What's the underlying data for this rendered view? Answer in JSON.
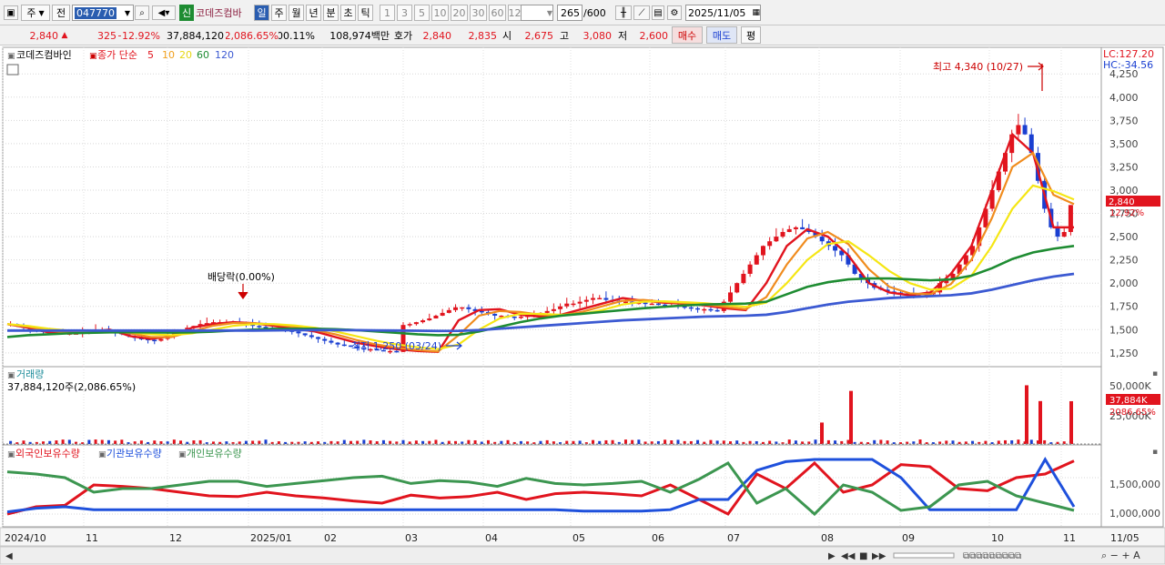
{
  "toolbar": {
    "type_combo": "주",
    "prev_label": "전",
    "stock_code": "047770",
    "new_badge": "신",
    "stock_name": "코데즈컴바",
    "periods": [
      "일",
      "주",
      "월",
      "년",
      "분",
      "초",
      "틱"
    ],
    "active_period": "일",
    "minutes": [
      "1",
      "3",
      "5",
      "10",
      "20",
      "30",
      "60",
      "120"
    ],
    "count": "265",
    "count_max": "/600",
    "date": "2025/11/05"
  },
  "quote": {
    "price": "2,840",
    "change": "325",
    "change_pct": "+12.92%",
    "volume": "37,884,120",
    "volume_pct": "2,086.65%",
    "turnover": "00.11%",
    "amount": "108,974백만",
    "hoga_label": "호가",
    "hoga": "2,840",
    "hoga2": "2,835",
    "open_label": "시",
    "open": "2,675",
    "high_label": "고",
    "high": "3,080",
    "low_label": "저",
    "low": "2,600",
    "buy_label": "매수",
    "sell_label": "매도",
    "avg_label": "평"
  },
  "price_pane": {
    "stock_name": "코데즈컴바인",
    "legend_label": "종가 단순",
    "ma_periods": [
      "5",
      "10",
      "20",
      "60",
      "120"
    ],
    "lc": "LC:127.20",
    "hc": "HC:-34.56",
    "high_marker": "최고 4,340 (10/27)",
    "low_marker": "최저 1,250 (03/24)",
    "dividend_marker": "배당락(0.00%)",
    "current_price": "2,840",
    "current_pct": "12.92%",
    "y_ticks": [
      "4,250",
      "4,000",
      "3,750",
      "3,500",
      "3,250",
      "3,000",
      "2,750",
      "2,500",
      "2,250",
      "2,000",
      "1,750",
      "1,500",
      "1,250"
    ]
  },
  "volume_pane": {
    "title": "거래량",
    "value_label": "37,884,120주(2,086.65%)",
    "y_ticks": [
      "50,000K",
      "25,000K"
    ],
    "current_value": "37,884K",
    "current_pct": "2086.65%"
  },
  "holdings_pane": {
    "legend": [
      "외국인보유수량",
      "기관보유수량",
      "개인보유수량"
    ],
    "y_ticks": [
      "1,500,000",
      "1,000,000"
    ]
  },
  "x_axis": {
    "labels": [
      "2024/10",
      "11",
      "12",
      "2025/01",
      "02",
      "03",
      "04",
      "05",
      "06",
      "07",
      "08",
      "09",
      "10",
      "11",
      "11/05"
    ]
  },
  "colors": {
    "up": "#e1141e",
    "down": "#1a3fd1",
    "ma5": "#e1141e",
    "ma10": "#f08c1e",
    "ma20": "#f5e614",
    "ma60": "#1e8c32",
    "ma120": "#3c5ad2",
    "foreign": "#e1141e",
    "institution": "#1e50dc",
    "individual": "#3c9650"
  },
  "chart_data": {
    "type": "line",
    "price_closes": [
      1560,
      1540,
      1520,
      1500,
      1490,
      1480,
      1470,
      1470,
      1460,
      1460,
      1460,
      1470,
      1480,
      1500,
      1500,
      1480,
      1470,
      1450,
      1430,
      1410,
      1400,
      1390,
      1380,
      1400,
      1430,
      1460,
      1490,
      1520,
      1540,
      1560,
      1570,
      1580,
      1580,
      1580,
      1580,
      1570,
      1560,
      1540,
      1530,
      1520,
      1510,
      1500,
      1490,
      1480,
      1460,
      1440,
      1420,
      1400,
      1380,
      1360,
      1340,
      1330,
      1320,
      1300,
      1290,
      1290,
      1280,
      1270,
      1270,
      1260,
      1550,
      1560,
      1580,
      1600,
      1620,
      1650,
      1680,
      1710,
      1740,
      1740,
      1720,
      1700,
      1690,
      1670,
      1650,
      1650,
      1640,
      1630,
      1640,
      1650,
      1670,
      1680,
      1700,
      1720,
      1750,
      1780,
      1780,
      1800,
      1820,
      1840,
      1840,
      1820,
      1810,
      1800,
      1800,
      1790,
      1790,
      1780,
      1780,
      1770,
      1760,
      1760,
      1750,
      1740,
      1730,
      1720,
      1720,
      1710,
      1700,
      1800,
      1900,
      2000,
      2100,
      2200,
      2300,
      2400,
      2450,
      2500,
      2550,
      2580,
      2600,
      2580,
      2550,
      2500,
      2450,
      2400,
      2350,
      2300,
      2200,
      2100,
      2050,
      2000,
      1950,
      1930,
      1910,
      1900,
      1890,
      1880,
      1870,
      1870,
      1880,
      1900,
      2000,
      2050,
      2100,
      2200,
      2300,
      2400,
      2600,
      2800,
      3000,
      3200,
      3400,
      3600,
      3700,
      3600,
      3400,
      3100,
      2800,
      2600,
      2500,
      2550,
      2840
    ],
    "price_dates_range": [
      "2024/10",
      "2025/11/05"
    ],
    "ma_series": [
      {
        "name": "5",
        "values": [
          1560,
          1520,
          1470,
          1460,
          1480,
          1500,
          1430,
          1400,
          1430,
          1520,
          1560,
          1580,
          1570,
          1540,
          1510,
          1480,
          1420,
          1360,
          1320,
          1290,
          1270,
          1260,
          1600,
          1710,
          1720,
          1660,
          1640,
          1660,
          1720,
          1780,
          1840,
          1810,
          1790,
          1780,
          1760,
          1730,
          1710,
          2000,
          2400,
          2580,
          2500,
          2300,
          2000,
          1900,
          1870,
          1900,
          2100,
          2400,
          3000,
          3600,
          3400,
          2600,
          2600
        ]
      },
      {
        "name": "10",
        "values": [
          1560,
          1530,
          1490,
          1470,
          1475,
          1490,
          1460,
          1420,
          1420,
          1480,
          1540,
          1570,
          1570,
          1555,
          1530,
          1495,
          1450,
          1390,
          1340,
          1305,
          1280,
          1265,
          1440,
          1650,
          1700,
          1690,
          1660,
          1650,
          1690,
          1750,
          1810,
          1820,
          1800,
          1785,
          1770,
          1745,
          1720,
          1850,
          2200,
          2480,
          2550,
          2420,
          2150,
          1960,
          1890,
          1880,
          1990,
          2250,
          2700,
          3250,
          3400,
          2950,
          2850
        ]
      },
      {
        "name": "20",
        "values": [
          1560,
          1540,
          1510,
          1490,
          1480,
          1485,
          1470,
          1450,
          1440,
          1460,
          1500,
          1540,
          1560,
          1560,
          1545,
          1520,
          1480,
          1430,
          1380,
          1340,
          1310,
          1290,
          1340,
          1500,
          1620,
          1670,
          1670,
          1660,
          1670,
          1710,
          1770,
          1800,
          1805,
          1795,
          1785,
          1765,
          1745,
          1790,
          2000,
          2250,
          2420,
          2450,
          2300,
          2130,
          2000,
          1930,
          1940,
          2080,
          2400,
          2800,
          3050,
          2990,
          2900
        ]
      },
      {
        "name": "60",
        "values": [
          1420,
          1440,
          1450,
          1460,
          1465,
          1470,
          1472,
          1470,
          1468,
          1470,
          1478,
          1490,
          1500,
          1508,
          1510,
          1510,
          1505,
          1495,
          1480,
          1465,
          1450,
          1440,
          1445,
          1480,
          1530,
          1580,
          1620,
          1650,
          1670,
          1690,
          1710,
          1730,
          1745,
          1760,
          1770,
          1775,
          1780,
          1800,
          1880,
          1960,
          2010,
          2040,
          2050,
          2050,
          2040,
          2030,
          2040,
          2080,
          2160,
          2260,
          2330,
          2370,
          2400
        ]
      },
      {
        "name": "120",
        "values": [
          1490,
          1490,
          1490,
          1490,
          1490,
          1490,
          1490,
          1490,
          1490,
          1490,
          1490,
          1490,
          1490,
          1492,
          1494,
          1495,
          1495,
          1494,
          1492,
          1490,
          1488,
          1486,
          1487,
          1495,
          1510,
          1525,
          1540,
          1555,
          1570,
          1585,
          1600,
          1610,
          1620,
          1630,
          1640,
          1645,
          1650,
          1660,
          1690,
          1730,
          1770,
          1800,
          1820,
          1840,
          1850,
          1860,
          1870,
          1890,
          1930,
          1980,
          2030,
          2070,
          2100
        ]
      }
    ],
    "volume_spikes_K": [
      {
        "date": "2025/08",
        "value": 19000
      },
      {
        "date": "2025/08",
        "value": 47000
      },
      {
        "date": "2025/10",
        "value": 52000
      },
      {
        "date": "2025/10",
        "value": 38000
      },
      {
        "date": "2025/11",
        "value": 37884
      }
    ],
    "holdings_series": [
      {
        "name": "외국인보유수량",
        "values": [
          1000000,
          1100000,
          1120000,
          1400000,
          1380000,
          1350000,
          1300000,
          1250000,
          1240000,
          1300000,
          1250000,
          1220000,
          1180000,
          1150000,
          1260000,
          1220000,
          1240000,
          1300000,
          1200000,
          1280000,
          1300000,
          1280000,
          1250000,
          1400000,
          1200000,
          1000000,
          1550000,
          1350000,
          1700000,
          1300000,
          1400000,
          1680000,
          1650000,
          1350000,
          1320000,
          1500000,
          1550000,
          1730000
        ]
      },
      {
        "name": "기관보유수량",
        "values": [
          1030000,
          1080000,
          1100000,
          1060000,
          1060000,
          1060000,
          1060000,
          1060000,
          1060000,
          1060000,
          1060000,
          1060000,
          1060000,
          1060000,
          1060000,
          1060000,
          1060000,
          1060000,
          1060000,
          1060000,
          1040000,
          1040000,
          1040000,
          1060000,
          1200000,
          1200000,
          1600000,
          1720000,
          1750000,
          1750000,
          1750000,
          1500000,
          1060000,
          1060000,
          1060000,
          1060000,
          1750000,
          1100000
        ]
      },
      {
        "name": "개인보유수량",
        "values": [
          1580000,
          1550000,
          1500000,
          1300000,
          1350000,
          1350000,
          1400000,
          1450000,
          1450000,
          1380000,
          1420000,
          1460000,
          1500000,
          1520000,
          1420000,
          1460000,
          1440000,
          1380000,
          1490000,
          1420000,
          1400000,
          1420000,
          1450000,
          1300000,
          1480000,
          1700000,
          1150000,
          1350000,
          1000000,
          1400000,
          1300000,
          1050000,
          1100000,
          1400000,
          1450000,
          1250000,
          1150000,
          1050000
        ]
      }
    ]
  }
}
